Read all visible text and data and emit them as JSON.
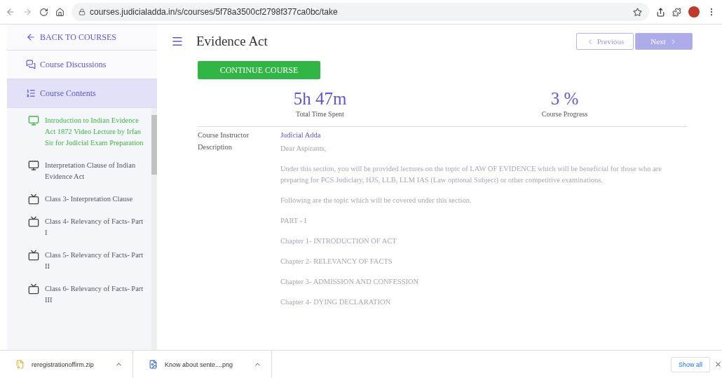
{
  "browser": {
    "url": "courses.judicialadda.in/s/courses/5f78a3500cf2798f377ca0bc/take"
  },
  "sidebar": {
    "back": "BACK TO COURSES",
    "nav": [
      {
        "label": "Course Discussions",
        "kind": "discussions",
        "selected": false
      },
      {
        "label": "Course Contents",
        "kind": "contents",
        "selected": true
      }
    ],
    "lessons": [
      {
        "title": "Introduction to Indian Evidence Act 1872 Video Lecture by Irfan Sir for Judicial Exam Preparation",
        "kind": "monitor",
        "selected": true
      },
      {
        "title": "Interpretation Clause of Indian Evidence Act",
        "kind": "monitor",
        "selected": false
      },
      {
        "title": "Class 3- Interpretation Clause",
        "kind": "tv",
        "selected": false
      },
      {
        "title": "Class 4- Relevancy of Facts- Part I",
        "kind": "tv",
        "selected": false
      },
      {
        "title": "Class 5- Relevancy of Facts- Part II",
        "kind": "tv",
        "selected": false
      },
      {
        "title": "Class 6- Relevancy of Facts- Part III",
        "kind": "tv",
        "selected": false
      }
    ]
  },
  "header": {
    "title": "Evidence Act",
    "previous": "Previous",
    "next": "Next"
  },
  "continue_button": "CONTINUE COURSE",
  "stats": [
    {
      "value": "5h 47m",
      "label": "Total Time Spent"
    },
    {
      "value": "3 %",
      "label": "Course Progress"
    }
  ],
  "details": {
    "instructor_label": "Course Instructor",
    "instructor": "Judicial Adda",
    "description_label": "Description",
    "description": [
      "Dear Aspirants,",
      "Under this section, you will be provided lectures on the topic of LAW OF EVIDENCE which will be beneficial for those who are preparing for PCS Judiciary, HJS, LLB, LLM IAS (Law optional Subject) or other competitive examinations.",
      "Following are the topic which will be covered under this section.",
      "PART - I",
      "Chapter 1- INTRODUCTION OF ACT",
      "Chapter 2- RELEVANCY OF FACTS",
      "Chapter 3- ADMISSION AND CONFESSION",
      "Chapter 4- DYING DECLARATION"
    ]
  },
  "downloads": {
    "files": [
      {
        "name": "reregistrationoffirm.zip",
        "kind": "zip"
      },
      {
        "name": "Know about sente....png",
        "kind": "image"
      }
    ],
    "show_all": "Show all"
  }
}
